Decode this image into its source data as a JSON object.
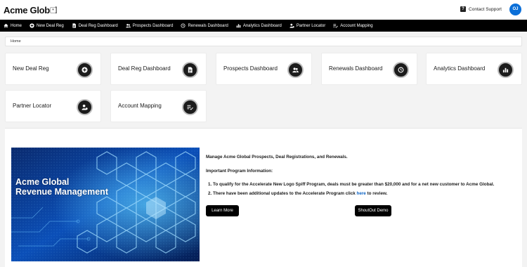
{
  "header": {
    "brand": "Acme Global",
    "brand_caret": "▾",
    "contact_icon": "?",
    "contact": "Contact Support",
    "avatar": "OJ"
  },
  "nav": [
    {
      "label": "Home",
      "icon": "home-icon"
    },
    {
      "label": "New Deal Reg",
      "icon": "plus-circle-icon"
    },
    {
      "label": "Deal Reg Dashboard",
      "icon": "document-icon"
    },
    {
      "label": "Prospects Dashboard",
      "icon": "people-icon"
    },
    {
      "label": "Renewals Dashboard",
      "icon": "history-icon"
    },
    {
      "label": "Analytics Dashboard",
      "icon": "bar-chart-icon"
    },
    {
      "label": "Partner Locator",
      "icon": "person-pin-icon"
    },
    {
      "label": "Account Mapping",
      "icon": "list-check-icon"
    }
  ],
  "breadcrumb": "Home",
  "tiles": [
    {
      "label": "New Deal Reg",
      "icon": "plus-circle-icon"
    },
    {
      "label": "Deal Reg Dashboard",
      "icon": "document-icon"
    },
    {
      "label": "Prospects Dashboard",
      "icon": "people-icon"
    },
    {
      "label": "Renewals Dashboard",
      "icon": "history-icon"
    },
    {
      "label": "Analytics Dashboard",
      "icon": "bar-chart-icon"
    },
    {
      "label": "Partner Locator",
      "icon": "person-pin-icon"
    },
    {
      "label": "Account Mapping",
      "icon": "list-check-icon"
    }
  ],
  "banner": {
    "line1": "Acme Global",
    "line2": "Revenue Management"
  },
  "info": {
    "intro": "Manage Acme Global Prospects, Deal Registrations, and Renewals.",
    "heading": "Important Program Information:",
    "item1": "To qualify for the Accelerate New Logo Spiff Program, deals must be greater than $20,000 and for a net new customer to Acme Global.",
    "item2_before": "There have been additional updates to the Accelerate Program click ",
    "item2_link": "here",
    "item2_after": " to review."
  },
  "buttons": {
    "learn_more": "Learn More",
    "demo": "ShoutOut Demo"
  },
  "colors": {
    "nav_bg": "#000000",
    "avatar": "#0b6fd8",
    "link": "#0b62c4"
  }
}
